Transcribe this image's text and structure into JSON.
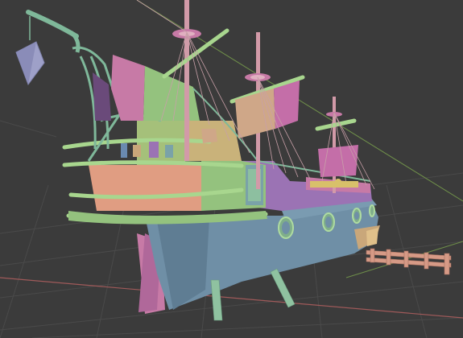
{
  "viewport": {
    "background": "#3b3b3b",
    "grid_color": "#4a4a4a",
    "axis_x_color": "#a05a5a",
    "axis_y_color": "#6f8f4a"
  },
  "palette": {
    "hull_blue": "#6f8fa6",
    "hull_blue_dark": "#5f7d93",
    "keel_pink": "#c77aa6",
    "deck_green": "#94c27e",
    "cabin_peach": "#e09d82",
    "cabin_tan": "#c9a77a",
    "sail_pink": "#c46ea8",
    "sail_tan": "#cfa788",
    "trim_teal": "#7fb89a",
    "rigging": "#c8a0a8",
    "mast_pink": "#d29aa8",
    "mast_dark": "#b06a80",
    "lantern_lilac": "#9ea0c8",
    "dock_salmon": "#d69a86"
  }
}
